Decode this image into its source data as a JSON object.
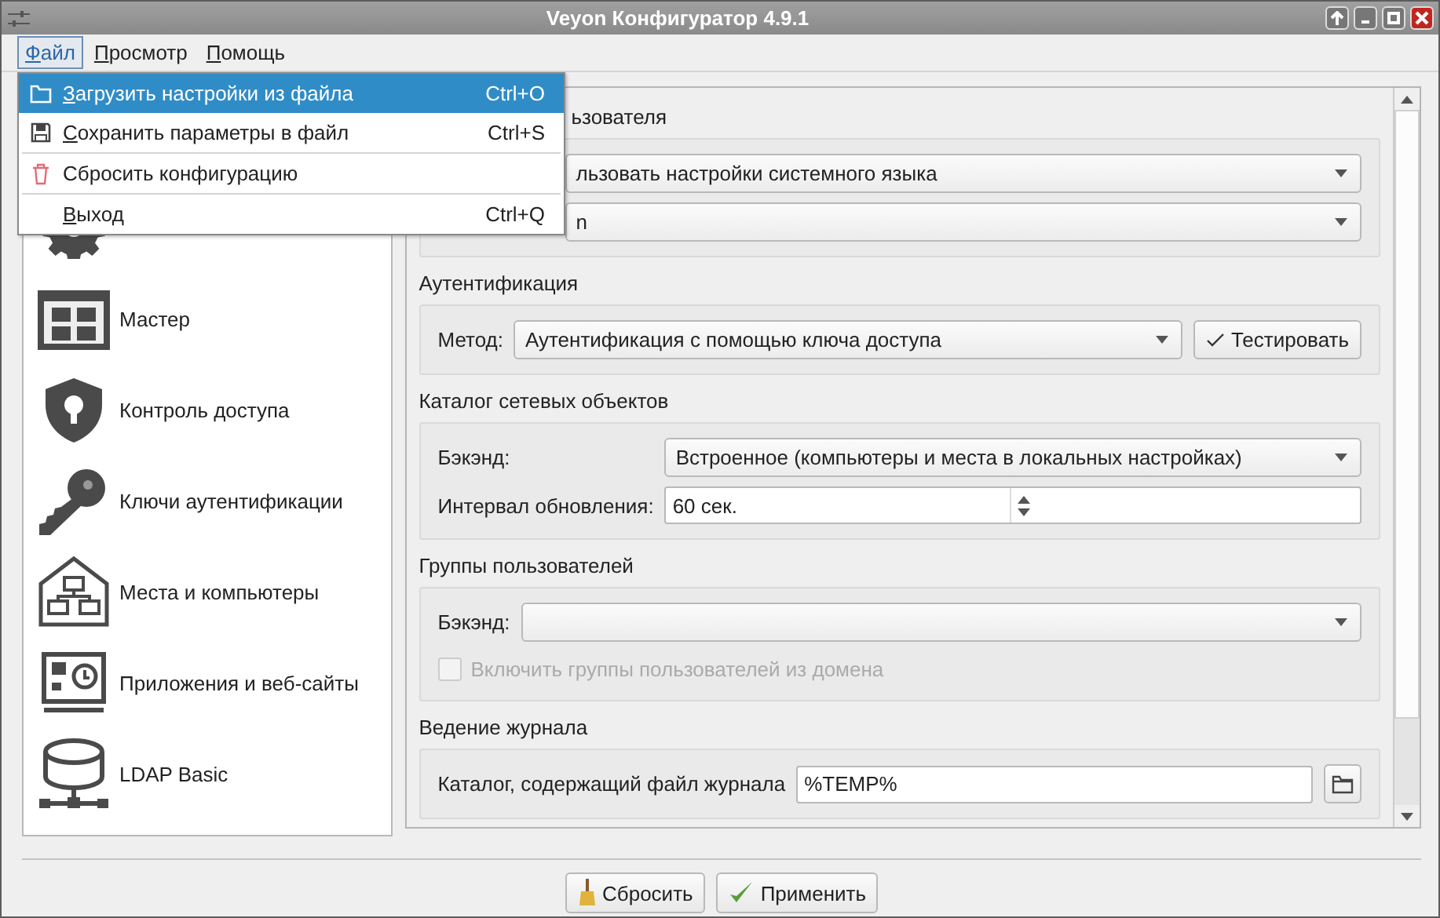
{
  "window": {
    "title": "Veyon Конфигуратор 4.9.1"
  },
  "menu_bar": [
    {
      "label": "Файл",
      "selected": true
    },
    {
      "label": "Просмотр",
      "selected": false
    },
    {
      "label": "Помощь",
      "selected": false
    }
  ],
  "file_menu": [
    {
      "kind": "folder",
      "label": "Загрузить настройки из файла",
      "shortcut": "Ctrl+O",
      "selected": true,
      "mnemonic": true,
      "separator_before": false
    },
    {
      "kind": "save",
      "label": "Сохранить параметры в файл",
      "shortcut": "Ctrl+S",
      "selected": false,
      "mnemonic": true,
      "separator_before": false
    },
    {
      "kind": "trash",
      "label": "Сбросить конфигурацию",
      "selected": false,
      "mnemonic": false,
      "separator_before": true
    },
    {
      "kind": "plain",
      "label": "Выход",
      "shortcut": "Ctrl+Q",
      "selected": false,
      "mnemonic": true,
      "separator_before": true
    }
  ],
  "sidebar": {
    "items": [
      {
        "kind": "gear"
      },
      {
        "kind": "wizard",
        "label": "Мастер"
      },
      {
        "kind": "shield",
        "label": "Контроль доступа"
      },
      {
        "kind": "key",
        "label": "Ключи аутентификации"
      },
      {
        "kind": "house",
        "label": "Места и компьютеры"
      },
      {
        "kind": "apps",
        "label": "Приложения и веб-сайты"
      },
      {
        "kind": "database",
        "label": "LDAP Basic"
      }
    ]
  },
  "sections": [
    {
      "title": "ьзователя",
      "rows": [
        {
          "kind": "combo",
          "value": "льзовать настройки системного языка"
        },
        {
          "kind": "combo",
          "value": "n"
        }
      ]
    },
    {
      "title": "Аутентификация",
      "rows": [
        {
          "kind": "combo",
          "label": "Метод:",
          "value": "Аутентификация с помощью ключа доступа",
          "button": "Тестировать"
        }
      ]
    },
    {
      "title": "Каталог сетевых объектов",
      "rows": [
        {
          "kind": "combo",
          "label": "Бэкэнд:",
          "value": "Встроенное (компьютеры и места в локальных настройках)"
        },
        {
          "kind": "spin",
          "label": "Интервал обновления:",
          "value": "60 сек."
        }
      ]
    },
    {
      "title": "Группы пользователей",
      "rows": [
        {
          "kind": "combo",
          "label": "Бэкэнд:"
        },
        {
          "kind": "checkbox",
          "label": "Включить группы пользователей из домена",
          "checked": false,
          "disabled": true
        }
      ]
    },
    {
      "title": "Ведение журнала",
      "rows": [
        {
          "kind": "path",
          "label": "Каталог, содержащий файл журнала",
          "value": "%TEMP%"
        }
      ]
    }
  ],
  "buttons": [
    {
      "kind": "reset",
      "label": "Сбросить"
    },
    {
      "kind": "apply",
      "label": "Применить"
    }
  ]
}
